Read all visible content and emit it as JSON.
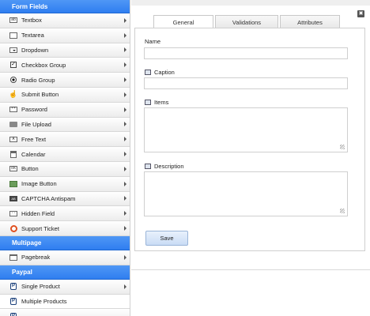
{
  "sidebar": {
    "sections": [
      {
        "title": "Form Fields",
        "items": [
          {
            "label": "Textbox",
            "icon": "textbox-icon"
          },
          {
            "label": "Textarea",
            "icon": "textarea-icon"
          },
          {
            "label": "Dropdown",
            "icon": "dropdown-icon"
          },
          {
            "label": "Checkbox Group",
            "icon": "checkbox-icon"
          },
          {
            "label": "Radio Group",
            "icon": "radio-icon"
          },
          {
            "label": "Submit Button",
            "icon": "hand-pointer-icon"
          },
          {
            "label": "Password",
            "icon": "password-icon"
          },
          {
            "label": "File Upload",
            "icon": "file-upload-icon"
          },
          {
            "label": "Free Text",
            "icon": "free-text-icon"
          },
          {
            "label": "Calendar",
            "icon": "calendar-icon"
          },
          {
            "label": "Button",
            "icon": "button-icon"
          },
          {
            "label": "Image Button",
            "icon": "image-icon"
          },
          {
            "label": "CAPTCHA Antispam",
            "icon": "captcha-icon"
          },
          {
            "label": "Hidden Field",
            "icon": "hidden-field-icon"
          },
          {
            "label": "Support Ticket",
            "icon": "lifebuoy-icon"
          }
        ]
      },
      {
        "title": "Multipage",
        "items": [
          {
            "label": "Pagebreak",
            "icon": "pagebreak-icon"
          }
        ]
      },
      {
        "title": "Paypal",
        "items": [
          {
            "label": "Single Product",
            "icon": "paypal-icon"
          },
          {
            "label": "Multiple Products",
            "icon": "paypal-icon"
          }
        ]
      }
    ]
  },
  "tabs": [
    "General",
    "Validations",
    "Attributes"
  ],
  "active_tab": "General",
  "form": {
    "name_label": "Name",
    "caption_label": "Caption",
    "items_label": "Items",
    "description_label": "Description",
    "save_label": "Save"
  },
  "colors": {
    "section_header": "#2f7ef0",
    "save_button": "#c9dcf5"
  }
}
